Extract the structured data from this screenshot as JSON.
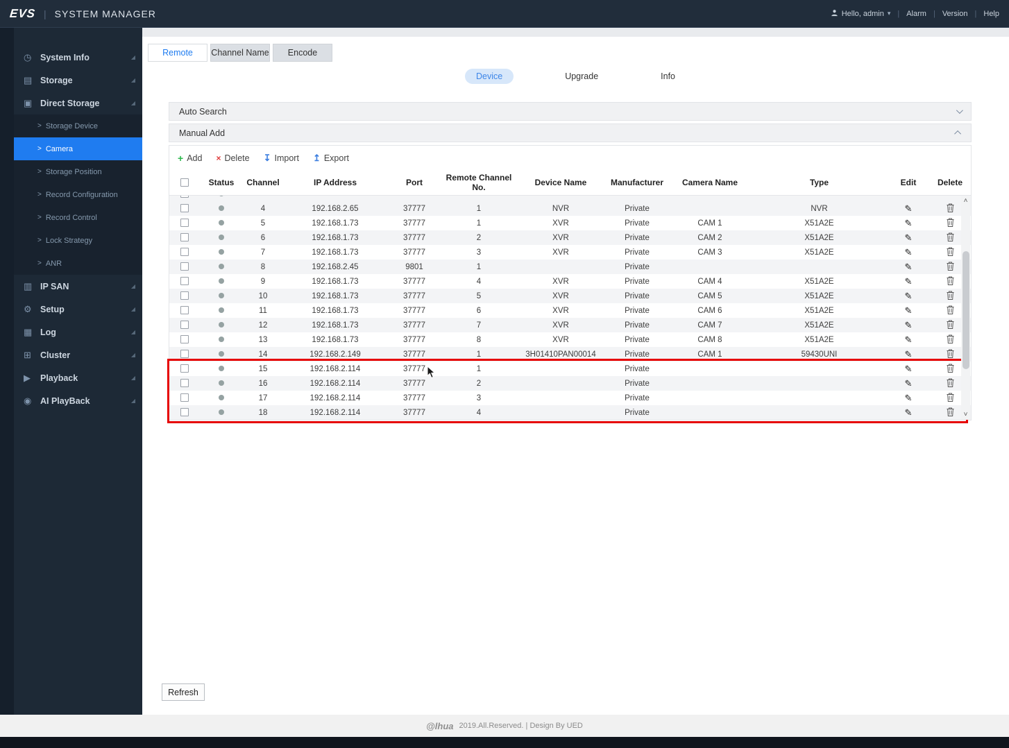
{
  "topbar": {
    "logo": "EVS",
    "title": "SYSTEM MANAGER",
    "user_label": "Hello, admin",
    "links": [
      {
        "label": "Alarm"
      },
      {
        "label": "Version"
      },
      {
        "label": "Help"
      }
    ]
  },
  "sidebar": {
    "items": [
      {
        "label": "System Info",
        "icon": "system-info-icon",
        "glyph": "◷"
      },
      {
        "label": "Storage",
        "icon": "storage-icon",
        "glyph": "▤"
      },
      {
        "label": "Direct Storage",
        "icon": "direct-storage-icon",
        "glyph": "▣",
        "expanded": true,
        "children": [
          {
            "label": "Storage Device"
          },
          {
            "label": "Camera",
            "selected": true
          },
          {
            "label": "Storage Position"
          },
          {
            "label": "Record Configuration"
          },
          {
            "label": "Record Control"
          },
          {
            "label": "Lock Strategy"
          },
          {
            "label": "ANR"
          }
        ]
      },
      {
        "label": "IP SAN",
        "icon": "ip-san-icon",
        "glyph": "▥"
      },
      {
        "label": "Setup",
        "icon": "setup-icon",
        "glyph": "⚙"
      },
      {
        "label": "Log",
        "icon": "log-icon",
        "glyph": "▦"
      },
      {
        "label": "Cluster",
        "icon": "cluster-icon",
        "glyph": "⊞"
      },
      {
        "label": "Playback",
        "icon": "playback-icon",
        "glyph": "▶"
      },
      {
        "label": "AI PlayBack",
        "icon": "ai-playback-icon",
        "glyph": "◉"
      }
    ]
  },
  "tabs": [
    {
      "label": "Remote",
      "active": true
    },
    {
      "label": "Channel Name"
    },
    {
      "label": "Encode"
    }
  ],
  "subnav": [
    {
      "label": "Device",
      "active": true
    },
    {
      "label": "Upgrade"
    },
    {
      "label": "Info"
    }
  ],
  "sections": {
    "auto_search": {
      "label": "Auto Search",
      "collapsed": true
    },
    "manual_add": {
      "label": "Manual Add",
      "collapsed": false
    }
  },
  "toolbar": {
    "add_label": "Add",
    "delete_label": "Delete",
    "import_label": "Import",
    "export_label": "Export"
  },
  "table": {
    "columns": [
      "",
      "Status",
      "Channel",
      "IP Address",
      "Port",
      "Remote Channel No.",
      "Device Name",
      "Manufacturer",
      "Camera Name",
      "Type",
      "Edit",
      "Delete"
    ],
    "partial_row_visible": true,
    "rows": [
      {
        "channel": "4",
        "ip": "192.168.2.65",
        "port": "37777",
        "remote": "1",
        "device": "NVR",
        "manufacturer": "Private",
        "camera": "",
        "type": "NVR"
      },
      {
        "channel": "5",
        "ip": "192.168.1.73",
        "port": "37777",
        "remote": "1",
        "device": "XVR",
        "manufacturer": "Private",
        "camera": "CAM 1",
        "type": "X51A2E"
      },
      {
        "channel": "6",
        "ip": "192.168.1.73",
        "port": "37777",
        "remote": "2",
        "device": "XVR",
        "manufacturer": "Private",
        "camera": "CAM 2",
        "type": "X51A2E"
      },
      {
        "channel": "7",
        "ip": "192.168.1.73",
        "port": "37777",
        "remote": "3",
        "device": "XVR",
        "manufacturer": "Private",
        "camera": "CAM 3",
        "type": "X51A2E"
      },
      {
        "channel": "8",
        "ip": "192.168.2.45",
        "port": "9801",
        "remote": "1",
        "device": "",
        "manufacturer": "Private",
        "camera": "",
        "type": ""
      },
      {
        "channel": "9",
        "ip": "192.168.1.73",
        "port": "37777",
        "remote": "4",
        "device": "XVR",
        "manufacturer": "Private",
        "camera": "CAM 4",
        "type": "X51A2E"
      },
      {
        "channel": "10",
        "ip": "192.168.1.73",
        "port": "37777",
        "remote": "5",
        "device": "XVR",
        "manufacturer": "Private",
        "camera": "CAM 5",
        "type": "X51A2E"
      },
      {
        "channel": "11",
        "ip": "192.168.1.73",
        "port": "37777",
        "remote": "6",
        "device": "XVR",
        "manufacturer": "Private",
        "camera": "CAM 6",
        "type": "X51A2E"
      },
      {
        "channel": "12",
        "ip": "192.168.1.73",
        "port": "37777",
        "remote": "7",
        "device": "XVR",
        "manufacturer": "Private",
        "camera": "CAM 7",
        "type": "X51A2E"
      },
      {
        "channel": "13",
        "ip": "192.168.1.73",
        "port": "37777",
        "remote": "8",
        "device": "XVR",
        "manufacturer": "Private",
        "camera": "CAM 8",
        "type": "X51A2E"
      },
      {
        "channel": "14",
        "ip": "192.168.2.149",
        "port": "37777",
        "remote": "1",
        "device": "3H01410PAN00014",
        "manufacturer": "Private",
        "camera": "CAM 1",
        "type": "59430UNI"
      },
      {
        "channel": "15",
        "ip": "192.168.2.114",
        "port": "37777",
        "remote": "1",
        "device": "",
        "manufacturer": "Private",
        "camera": "",
        "type": ""
      },
      {
        "channel": "16",
        "ip": "192.168.2.114",
        "port": "37777",
        "remote": "2",
        "device": "",
        "manufacturer": "Private",
        "camera": "",
        "type": ""
      },
      {
        "channel": "17",
        "ip": "192.168.2.114",
        "port": "37777",
        "remote": "3",
        "device": "",
        "manufacturer": "Private",
        "camera": "",
        "type": ""
      },
      {
        "channel": "18",
        "ip": "192.168.2.114",
        "port": "37777",
        "remote": "4",
        "device": "",
        "manufacturer": "Private",
        "camera": "",
        "type": ""
      }
    ],
    "highlighted_channels": [
      "15",
      "16",
      "17",
      "18"
    ]
  },
  "refresh_label": "Refresh",
  "footer": {
    "brand": "@lhua",
    "text": "2019.All.Reserved. | Design By UED"
  },
  "colors": {
    "accent_blue": "#1f7cf0",
    "highlight_red": "#e60000",
    "status_dot": "#95a2a2",
    "add_green": "#2db84d",
    "delete_red": "#e03c3c",
    "io_blue": "#3d7fe0"
  }
}
